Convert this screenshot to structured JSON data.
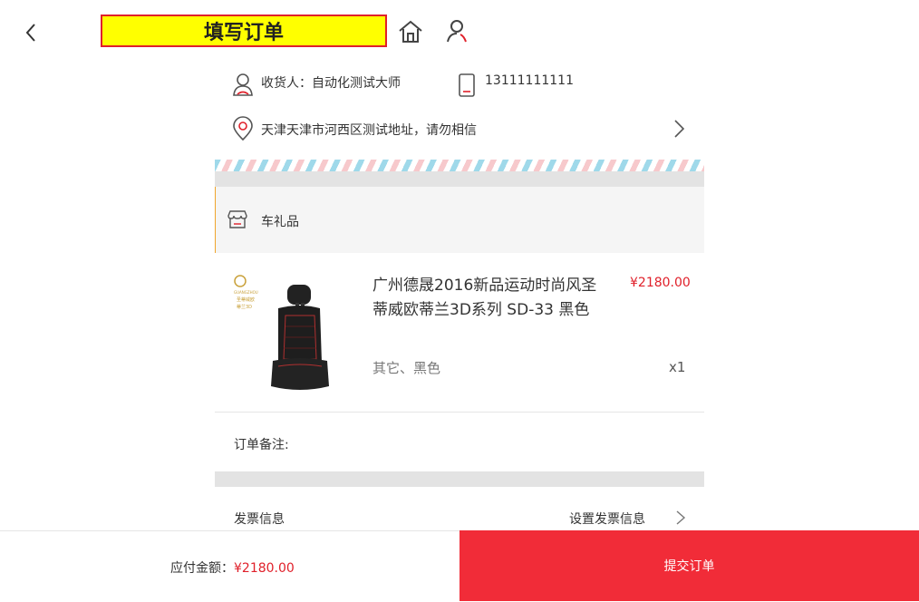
{
  "header": {
    "title": "填写订单"
  },
  "address": {
    "consignee": "收货人：自动化测试大师",
    "phone": "13111111111",
    "detail": "天津天津市河西区测试地址，请勿相信"
  },
  "shop": {
    "name": "车礼品"
  },
  "product": {
    "title": "广州德晟2016新品运动时尚风圣蒂威欧蒂兰3D系列 SD-33 黑色",
    "price": "¥2180.00",
    "spec": "其它、黑色",
    "qty": "x1",
    "image_caption": "圣蒂威欧蒂兰 3D系列SD-33"
  },
  "remark": {
    "label": "订单备注:"
  },
  "invoice": {
    "label": "发票信息",
    "link": "设置发票信息"
  },
  "footer": {
    "total_label": "应付金额：",
    "total_value": "¥2180.00",
    "submit_label": "提交订单"
  },
  "colors": {
    "accent": "#e0202a",
    "submit_bg": "#f12c38",
    "title_bg": "#ffff00"
  }
}
